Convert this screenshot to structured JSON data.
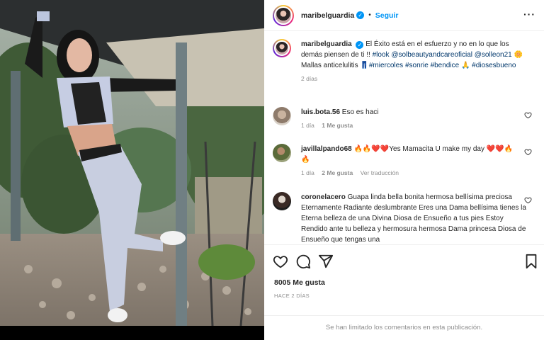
{
  "post": {
    "username": "maribelguardia",
    "follow_label": "Seguir",
    "more_label": "···",
    "caption_username": "maribelguardia",
    "caption_text": " El Éxito está en el esfuerzo y no en lo que los demás piensen de ti !! ",
    "caption_tags": [
      "#look",
      "@solbeautyandcareoficial",
      "@solleon21",
      "🌼Mallas anticelulitis 👖",
      "#miercoles",
      "#sonrie",
      "#bendice",
      "🙏",
      "#diosesbueno"
    ],
    "caption_age": "2 días",
    "likes": "8005 Me gusta",
    "posted_ago": "HACE 2 DÍAS",
    "comments_limited": "Se han limitado los comentarios en esta publicación."
  },
  "comments": [
    {
      "username": "luis.bota.56",
      "text": "Eso es haci",
      "age": "1 día",
      "likes": "1 Me gusta",
      "reply": ""
    },
    {
      "username": "javillalpando68",
      "text": "🔥🔥❤️❤️Yes Mamacita U make my day ❤️❤️🔥🔥",
      "age": "1 día",
      "likes": "2 Me gusta",
      "reply": "Ver traducción"
    },
    {
      "username": "coronelacero",
      "text": "Guapa linda bella bonita hermosa bellísima preciosa Eternamente Radiante deslumbrante Eres una Dama bellísima tienes la Eterna belleza de una Divina Diosa de Ensueño a tus pies Estoy Rendido ante tu belleza y hermosura hermosa Dama princesa Diosa de Ensueño que tengas una",
      "age": "",
      "likes": "",
      "reply": ""
    }
  ],
  "colors": {
    "link_blue": "#0095f6",
    "hashtag_blue": "#00376b",
    "muted_gray": "#8e8e8e"
  },
  "icons": [
    "verified-badge",
    "heart-icon",
    "comment-icon",
    "share-icon",
    "save-icon",
    "more-icon"
  ]
}
